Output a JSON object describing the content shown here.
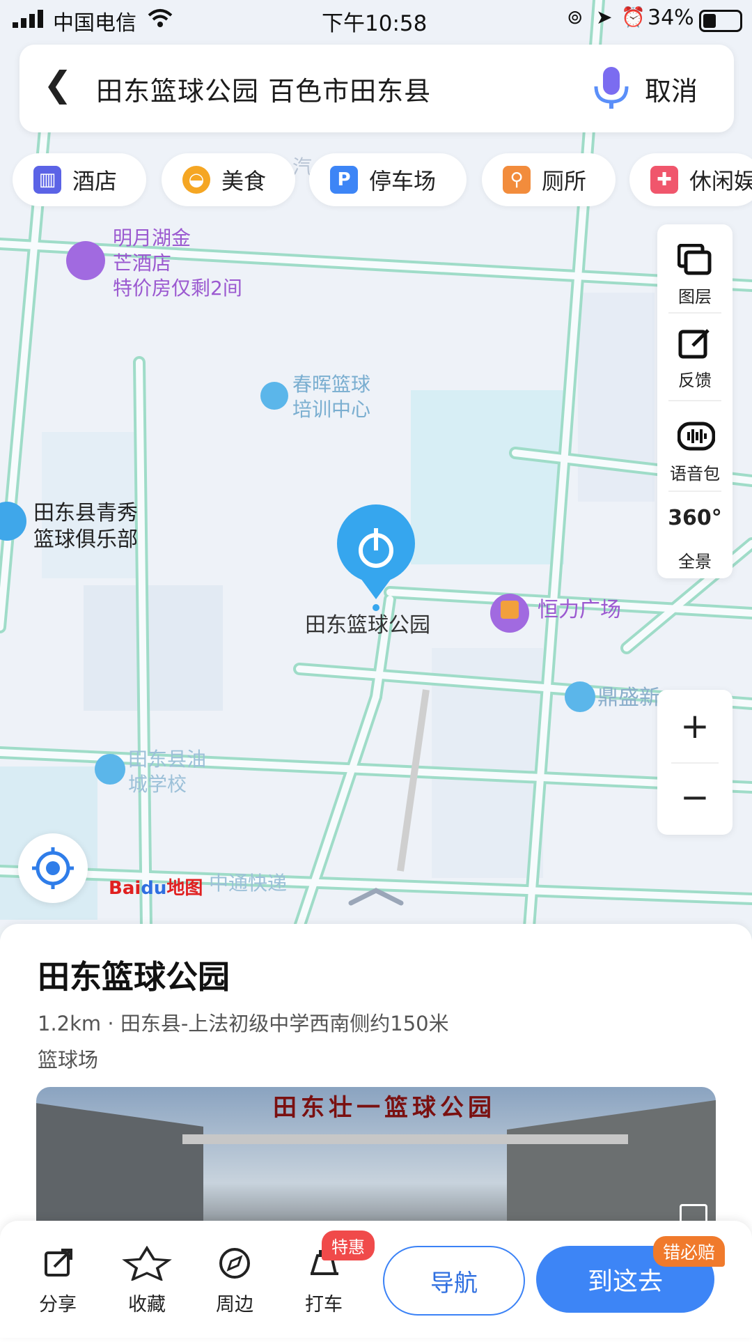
{
  "status_bar": {
    "carrier": "中国电信",
    "time": "下午10:58",
    "battery": "34%"
  },
  "search": {
    "query": "田东篮球公园 百色市田东县",
    "cancel_label": "取消"
  },
  "categories": [
    {
      "label": "酒店",
      "icon": "hotel-icon",
      "color": "#5b63e6"
    },
    {
      "label": "美食",
      "icon": "food-icon",
      "color": "#f5a623"
    },
    {
      "label": "停车场",
      "icon": "parking-icon",
      "color": "#3d85f6"
    },
    {
      "label": "厕所",
      "icon": "toilet-icon",
      "color": "#f28c3c"
    },
    {
      "label": "休闲娱",
      "icon": "gamepad-icon",
      "color": "#f0566c"
    }
  ],
  "map_tools": [
    {
      "label": "图层",
      "icon": "layers-icon"
    },
    {
      "label": "反馈",
      "icon": "feedback-icon"
    },
    {
      "label": "语音包",
      "icon": "voice-pack-icon"
    },
    {
      "label": "全景",
      "icon": "panorama-360-icon",
      "glyph": "360°"
    }
  ],
  "zoom": {
    "in": "+",
    "out": "−"
  },
  "map_labels": {
    "hotel_name_1": "明月湖金",
    "hotel_name_2": "芒酒店",
    "hotel_promo": "特价房仅剩2间",
    "chunhui_1": "春晖篮球",
    "chunhui_2": "培训中心",
    "qingxiu_1": "田东县青秀",
    "qingxiu_2": "篮球俱乐部",
    "destination": "田东篮球公园",
    "hengli": "恒力广场",
    "dingsheng": "鼎盛新",
    "youcheng_1": "田东县油",
    "youcheng_2": "城学校",
    "zhongtong": "中通快递",
    "road_fragment": "汽",
    "logo_bai": "Bai",
    "logo_du": "du",
    "logo_map": "地图"
  },
  "place": {
    "title": "田东篮球公园",
    "meta": "1.2km · 田东县-上法初级中学西南侧约150米",
    "category": "篮球场",
    "photo_sign": "田东壮一篮球公园"
  },
  "actions": [
    {
      "label": "分享",
      "icon": "share-icon"
    },
    {
      "label": "收藏",
      "icon": "star-icon"
    },
    {
      "label": "周边",
      "icon": "compass-icon"
    },
    {
      "label": "打车",
      "icon": "taxi-icon"
    }
  ],
  "taxi_badge": "特惠",
  "nav_label": "导航",
  "go_label": "到这去",
  "guarantee_badge": "错必赔"
}
